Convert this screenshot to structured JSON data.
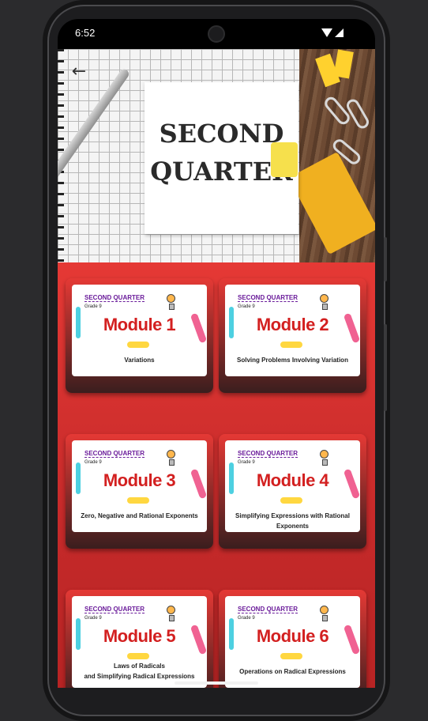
{
  "status_bar": {
    "time": "6:52",
    "wifi_icon": "wifi-icon",
    "signal_icon": "signal-icon"
  },
  "header": {
    "back_icon": "arrow-left-icon"
  },
  "banner": {
    "line1": "SECOND",
    "line2": "QUARTER"
  },
  "modules": [
    {
      "quarter": "SECOND QUARTER",
      "grade": "Grade 9",
      "module": "Module 1",
      "title_lines": [
        "Variations"
      ]
    },
    {
      "quarter": "SECOND QUARTER",
      "grade": "Grade 9",
      "module": "Module 2",
      "title_lines": [
        "Solving Problems Involving Variation"
      ]
    },
    {
      "quarter": "SECOND QUARTER",
      "grade": "Grade 9",
      "module": "Module 3",
      "title_lines": [
        "Zero, Negative and Rational Exponents"
      ]
    },
    {
      "quarter": "SECOND QUARTER",
      "grade": "Grade 9",
      "module": "Module 4",
      "title_lines": [
        "Simplifying Expressions with Rational Exponents"
      ]
    },
    {
      "quarter": "SECOND QUARTER",
      "grade": "Grade 9",
      "module": "Module 5",
      "title_lines": [
        "Laws of Radicals",
        "and Simplifying Radical Expressions"
      ]
    },
    {
      "quarter": "SECOND QUARTER",
      "grade": "Grade 9",
      "module": "Module 6",
      "title_lines": [
        "Operations on Radical Expressions"
      ]
    }
  ],
  "colors": {
    "accent": "#e53935",
    "module_text": "#d32020",
    "quarter_text": "#6a1b9a"
  }
}
